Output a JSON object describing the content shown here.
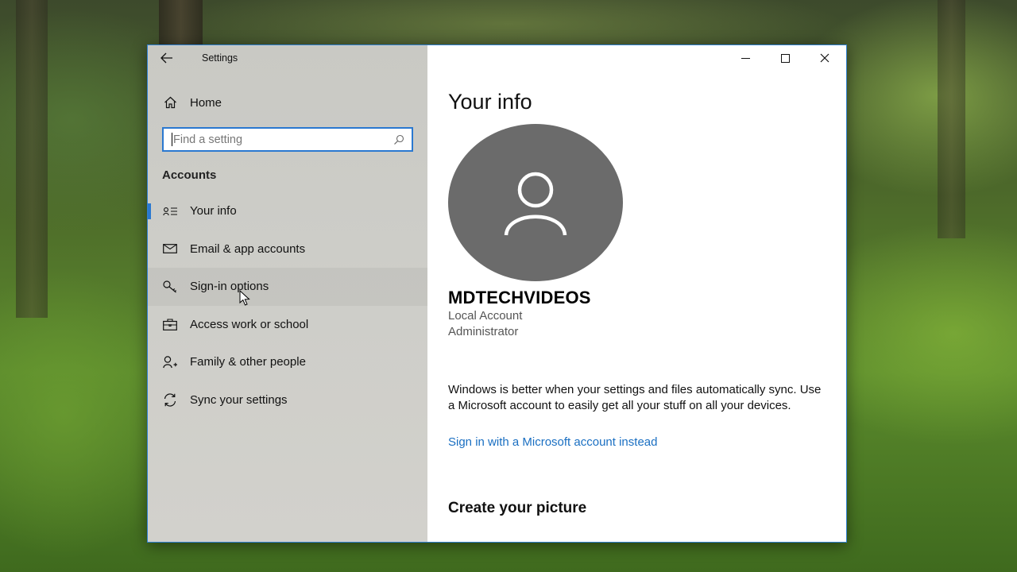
{
  "window": {
    "title": "Settings",
    "controls": {
      "minimize": "minimize",
      "maximize": "maximize",
      "close": "close"
    }
  },
  "sidebar": {
    "home_label": "Home",
    "search": {
      "placeholder": "Find a setting",
      "icon": "search-icon"
    },
    "section_title": "Accounts",
    "items": [
      {
        "label": "Your info",
        "icon": "contact-card-icon",
        "selected": true
      },
      {
        "label": "Email & app accounts",
        "icon": "mail-icon",
        "selected": false
      },
      {
        "label": "Sign-in options",
        "icon": "key-icon",
        "selected": false,
        "hovered": true
      },
      {
        "label": "Access work or school",
        "icon": "briefcase-icon",
        "selected": false
      },
      {
        "label": "Family & other people",
        "icon": "person-add-icon",
        "selected": false
      },
      {
        "label": "Sync your settings",
        "icon": "sync-icon",
        "selected": false
      }
    ]
  },
  "main": {
    "title": "Your info",
    "username": "MDTECHVIDEOS",
    "account_type": "Local Account",
    "account_role": "Administrator",
    "info_text": "Windows is better when your settings and files automatically sync. Use a Microsoft account to easily get all your stuff on all your devices.",
    "signin_link": "Sign in with a Microsoft account instead",
    "section_create": "Create your picture"
  },
  "colors": {
    "accent": "#2a78d0",
    "link": "#1a6fc2",
    "avatar_bg": "#6b6b6b",
    "sidebar_bg": "#cbcbc6"
  }
}
